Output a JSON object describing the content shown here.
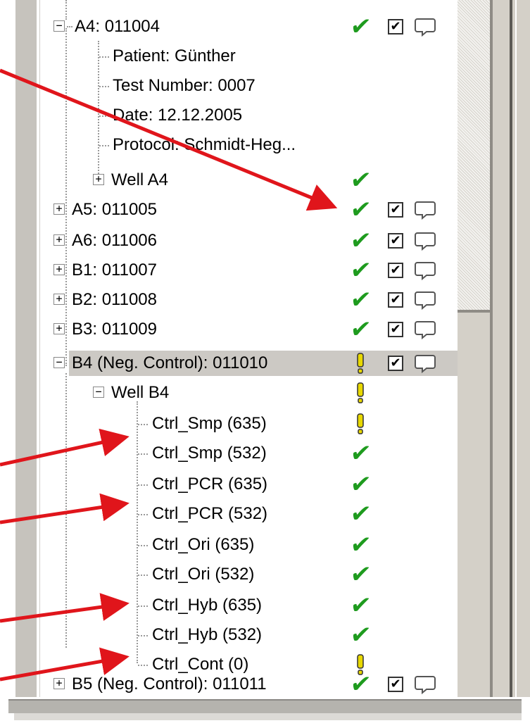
{
  "tree": {
    "rows": [
      {
        "label": "A4: 011004",
        "check": "✔",
        "box": "✔"
      },
      {
        "label": "Patient: Günther"
      },
      {
        "label": "Test Number: 0007"
      },
      {
        "label": "Date: 12.12.2005"
      },
      {
        "label": "Protocol: Schmidt-Heg..."
      },
      {
        "label": "Well A4",
        "check": "✔"
      },
      {
        "label": "A5: 011005",
        "check": "✔",
        "box": "✔"
      },
      {
        "label": "A6: 011006",
        "check": "✔",
        "box": "✔"
      },
      {
        "label": "B1: 011007",
        "check": "✔",
        "box": "✔"
      },
      {
        "label": "B2: 011008",
        "check": "✔",
        "box": "✔"
      },
      {
        "label": "B3: 011009",
        "check": "✔",
        "box": "✔"
      },
      {
        "label": "B4 (Neg. Control): 011010",
        "box": "✔"
      },
      {
        "label": "Well B4"
      },
      {
        "label": "Ctrl_Smp (635)"
      },
      {
        "label": "Ctrl_Smp (532)",
        "check": "✔"
      },
      {
        "label": "Ctrl_PCR (635)",
        "check": "✔"
      },
      {
        "label": "Ctrl_PCR (532)",
        "check": "✔"
      },
      {
        "label": "Ctrl_Ori (635)",
        "check": "✔"
      },
      {
        "label": "Ctrl_Ori (532)",
        "check": "✔"
      },
      {
        "label": "Ctrl_Hyb (635)",
        "check": "✔"
      },
      {
        "label": "Ctrl_Hyb (532)",
        "check": "✔"
      },
      {
        "label": "Ctrl_Cont (0)"
      },
      {
        "label": "B5 (Neg. Control): 011011",
        "check": "✔",
        "box": "✔"
      }
    ],
    "expanders": {
      "collapsed": "+",
      "expanded": "−"
    },
    "colors": {
      "check": "#1e9b1e",
      "warning": "#e8d800",
      "arrow": "#e0151b",
      "selected_row": "#ccc9c4"
    },
    "icons": [
      "status-check-icon",
      "status-warning-icon",
      "checkbox-icon",
      "comment-bubble-icon"
    ]
  }
}
